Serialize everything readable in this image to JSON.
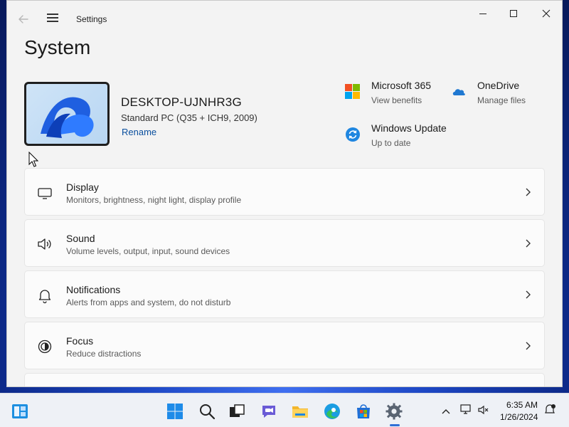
{
  "window": {
    "title": "Settings"
  },
  "page": {
    "title": "System"
  },
  "device": {
    "name": "DESKTOP-UJNHR3G",
    "model": "Standard PC (Q35 + ICH9, 2009)",
    "rename_label": "Rename"
  },
  "quick_links": [
    {
      "title": "Microsoft 365",
      "subtitle": "View benefits",
      "icon": "microsoft-365-icon"
    },
    {
      "title": "OneDrive",
      "subtitle": "Manage files",
      "icon": "onedrive-icon"
    },
    {
      "title": "Windows Update",
      "subtitle": "Up to date",
      "icon": "windows-update-icon"
    }
  ],
  "settings_items": [
    {
      "title": "Display",
      "subtitle": "Monitors, brightness, night light, display profile",
      "icon": "display-icon"
    },
    {
      "title": "Sound",
      "subtitle": "Volume levels, output, input, sound devices",
      "icon": "speaker-icon"
    },
    {
      "title": "Notifications",
      "subtitle": "Alerts from apps and system, do not disturb",
      "icon": "bell-icon"
    },
    {
      "title": "Focus",
      "subtitle": "Reduce distractions",
      "icon": "focus-icon"
    }
  ],
  "taskbar": {
    "apps": [
      "widgets",
      "start",
      "search",
      "task-view",
      "chat",
      "file-explorer",
      "edge",
      "store",
      "settings"
    ],
    "active_app": "settings",
    "clock": {
      "time": "6:35 AM",
      "date": "1/26/2024"
    }
  },
  "colors": {
    "accent": "#0a4f9e",
    "window_bg": "#f3f3f3",
    "card_bg": "#fbfbfb",
    "taskbar_bg": "#eef1f6"
  }
}
